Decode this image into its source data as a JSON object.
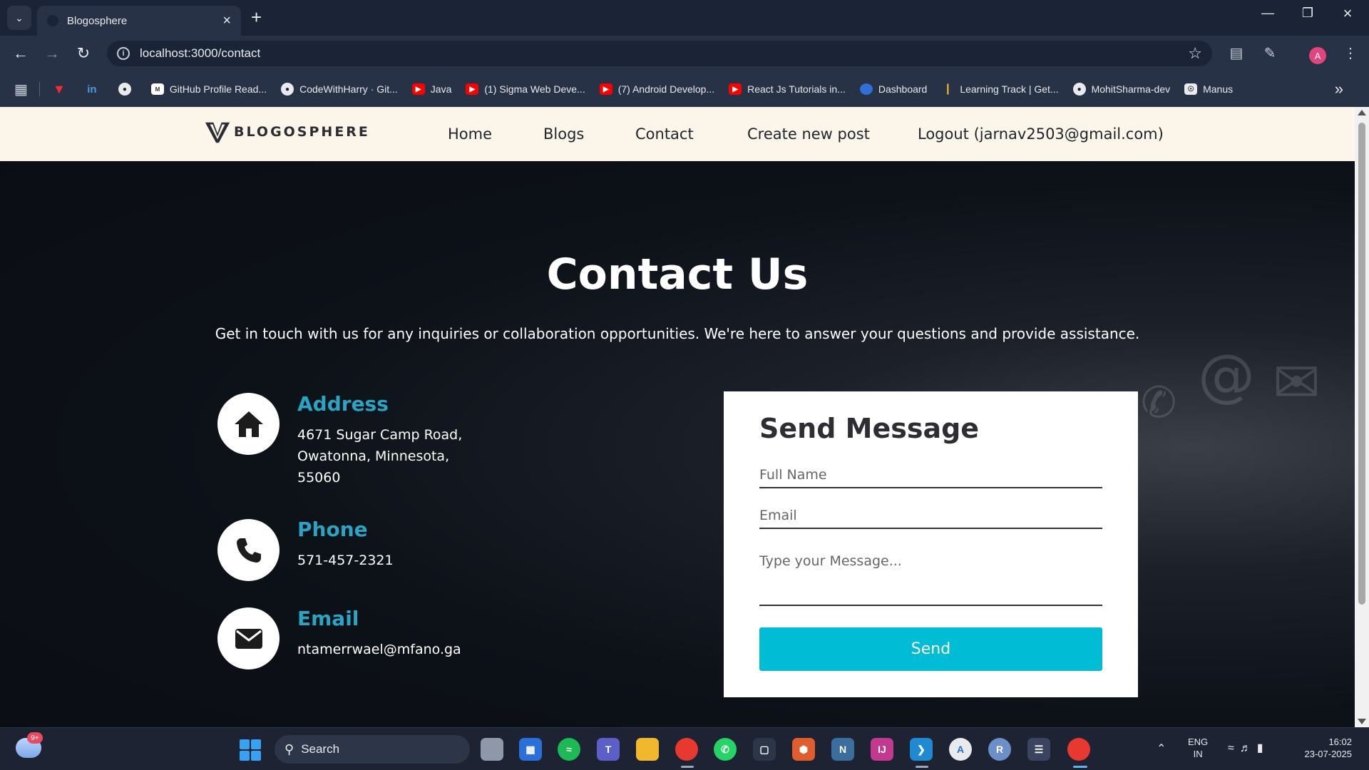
{
  "browser": {
    "tab_title": "Blogosphere",
    "url": "localhost:3000/contact",
    "bookmarks": [
      {
        "label": "GitHub Profile Read...",
        "icon": "generic-icon"
      },
      {
        "label": "CodeWithHarry · Git...",
        "icon": "github-icon"
      },
      {
        "label": "Java",
        "icon": "youtube-icon"
      },
      {
        "label": "(1) Sigma Web Deve...",
        "icon": "youtube-icon"
      },
      {
        "label": "(7) Android Develop...",
        "icon": "youtube-icon"
      },
      {
        "label": "React Js Tutorials in...",
        "icon": "youtube-icon"
      },
      {
        "label": "Dashboard",
        "icon": "dashboard-icon"
      },
      {
        "label": "Learning Track | Get...",
        "icon": "learning-track-icon"
      },
      {
        "label": "MohitSharma-dev",
        "icon": "github-icon"
      },
      {
        "label": "Manus",
        "icon": "manus-icon"
      }
    ],
    "profile_initial": "A"
  },
  "site": {
    "logo_text": "BLOGOSPHERE",
    "nav": {
      "home": "Home",
      "blogs": "Blogs",
      "contact": "Contact",
      "create": "Create new post",
      "logout": "Logout (jarnav2503@gmail.com)"
    }
  },
  "contact": {
    "title": "Contact Us",
    "subtitle": "Get in touch with us for any inquiries or collaboration opportunities. We're here to answer your questions and provide assistance.",
    "address": {
      "heading": "Address",
      "line1": "4671 Sugar Camp Road,",
      "line2": "Owatonna, Minnesota,",
      "line3": "55060"
    },
    "phone": {
      "heading": "Phone",
      "value": "571-457-2321"
    },
    "email": {
      "heading": "Email",
      "value": "ntamerrwael@mfano.ga"
    }
  },
  "form": {
    "title": "Send Message",
    "name_placeholder": "Full Name",
    "email_placeholder": "Email",
    "message_placeholder": "Type your Message...",
    "send_label": "Send"
  },
  "taskbar": {
    "weather_badge": "9+",
    "search_label": "Search",
    "lang_line1": "ENG",
    "lang_line2": "IN",
    "time": "16:02",
    "date": "23-07-2025"
  },
  "colors": {
    "accent": "#00bcd4",
    "heading_teal": "#2ba3c2",
    "nav_bg": "#fbf6e9"
  }
}
